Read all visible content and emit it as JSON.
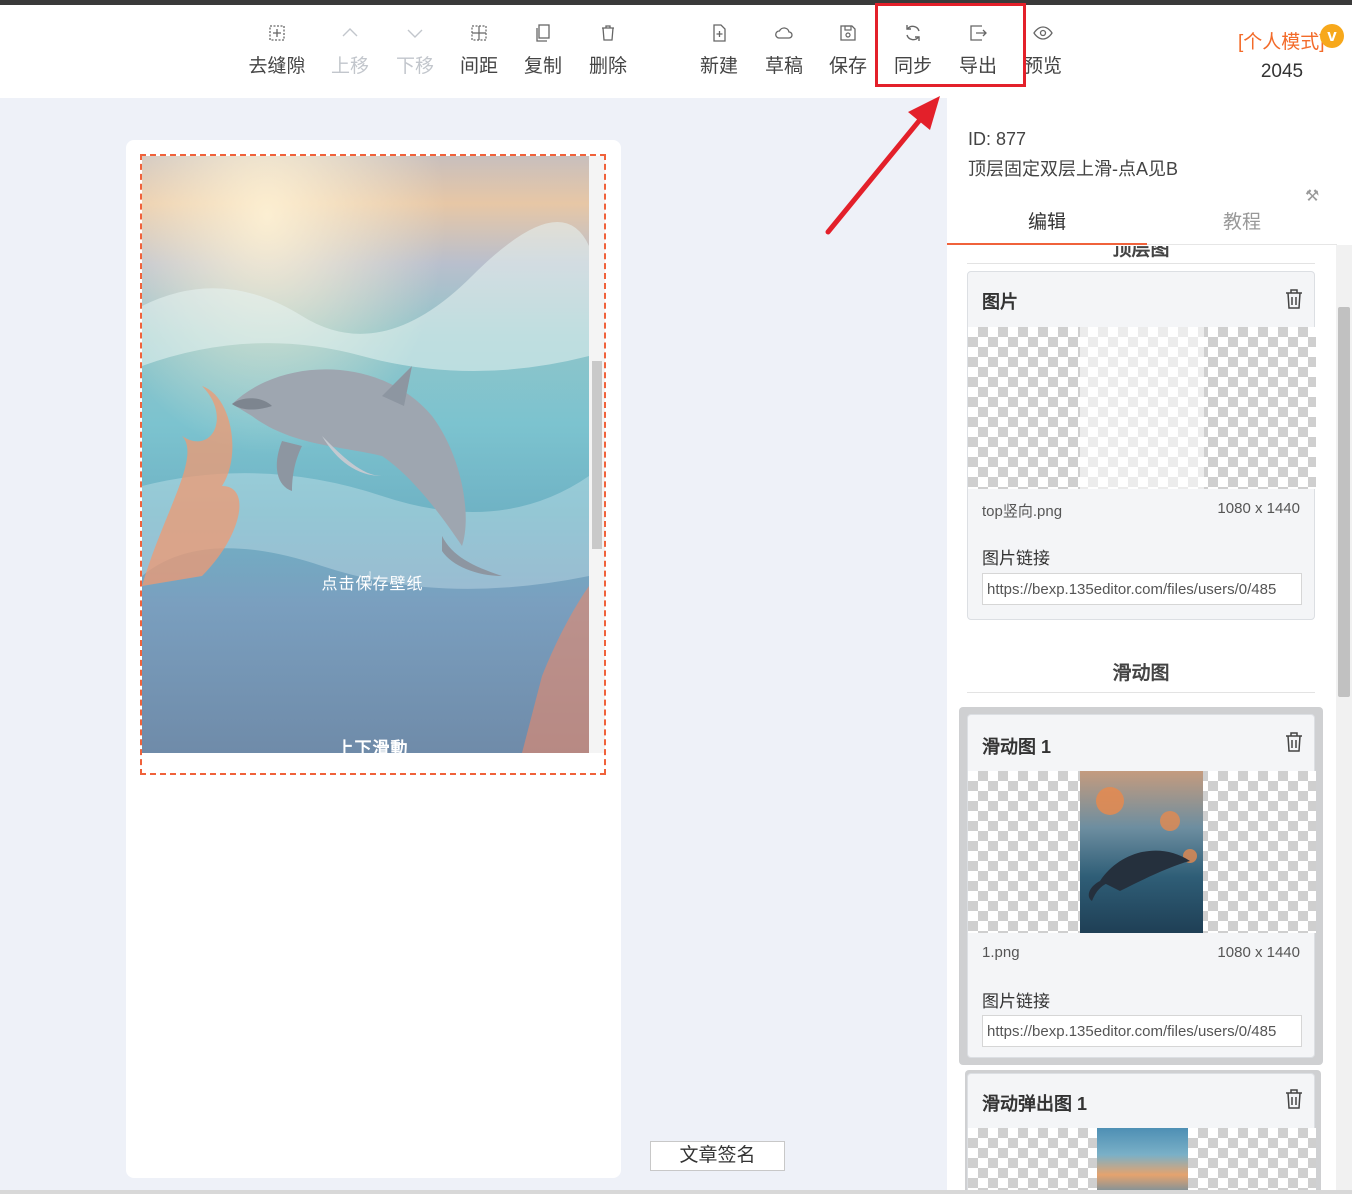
{
  "toolbar": {
    "items": [
      {
        "label": "去缝隙",
        "icon": "grid-plus-icon"
      },
      {
        "label": "上移",
        "icon": "chevron-up-icon"
      },
      {
        "label": "下移",
        "icon": "chevron-down-icon"
      },
      {
        "label": "间距",
        "icon": "spacing-icon"
      },
      {
        "label": "复制",
        "icon": "copy-icon"
      },
      {
        "label": "删除",
        "icon": "trash-icon"
      },
      {
        "label": "新建",
        "icon": "new-file-icon"
      },
      {
        "label": "草稿",
        "icon": "cloud-icon"
      },
      {
        "label": "保存",
        "icon": "save-icon"
      },
      {
        "label": "同步",
        "icon": "sync-icon"
      },
      {
        "label": "导出",
        "icon": "export-icon"
      },
      {
        "label": "预览",
        "icon": "eye-icon"
      }
    ],
    "mode": "[个人模式]",
    "vip_badge": "v",
    "count": "2045"
  },
  "colors": {
    "accent": "#f0623b",
    "highlight": "#e3202a",
    "vip": "#f7a81b"
  },
  "canvas": {
    "overlay_hint": "点击保存壁纸",
    "overlay_scroll": "上下滑動",
    "sign_button": "文章签名"
  },
  "panel": {
    "id_line": "ID: 877",
    "template_name": "顶层固定双层上滑-点A见B",
    "tabs": [
      {
        "label": "编辑"
      },
      {
        "label": "教程"
      }
    ],
    "section_top_partial": "顶层图",
    "image_card": {
      "title": "图片",
      "filename": "top竖向.png",
      "size": "1080 x 1440",
      "link_label": "图片链接",
      "link_value": "https://bexp.135editor.com/files/users/0/485"
    },
    "section_slide": "滑动图",
    "slide_card": {
      "title": "滑动图 1",
      "filename": "1.png",
      "size": "1080 x 1440",
      "link_label": "图片链接",
      "link_value": "https://bexp.135editor.com/files/users/0/485"
    },
    "popup_card": {
      "title": "滑动弹出图 1"
    }
  }
}
